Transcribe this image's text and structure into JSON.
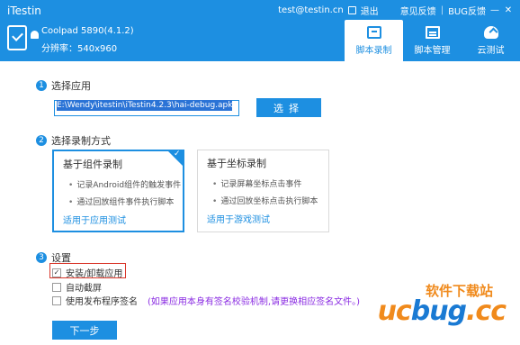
{
  "app": {
    "title": "iTestin"
  },
  "top_bar": {
    "email": "test@testin.cn",
    "logout": "退出",
    "feedback": "意见反馈",
    "bug_feedback": "BUG反馈",
    "separator": "|",
    "minimize": "—",
    "close": "✕"
  },
  "device": {
    "name": "Coolpad 5890(4.1.2)",
    "resolution": "分辨率：540x960"
  },
  "tabs": [
    {
      "label": "脚本录制",
      "icon": "script-record-icon",
      "active": true
    },
    {
      "label": "脚本管理",
      "icon": "script-manage-icon",
      "active": false
    },
    {
      "label": "云测试",
      "icon": "cloud-test-icon",
      "active": false
    }
  ],
  "steps": {
    "select_app": {
      "num": "1",
      "label": "选择应用"
    },
    "record_mode": {
      "num": "2",
      "label": "选择录制方式"
    },
    "settings": {
      "num": "3",
      "label": "设置"
    }
  },
  "app_path": {
    "value": "E:\\Wendy\\itestin\\iTestin4.2.3\\hai-debug.apk"
  },
  "select_button": "选择",
  "record_modes": [
    {
      "title": "基于组件录制",
      "bullets": [
        "记录Android组件的触发事件",
        "通过回放组件事件执行脚本"
      ],
      "link": "适用于应用测试",
      "active": true
    },
    {
      "title": "基于坐标录制",
      "bullets": [
        "记录屏幕坐标点击事件",
        "通过回放坐标点击执行脚本"
      ],
      "link": "适用于游戏测试",
      "active": false
    }
  ],
  "settings": {
    "install_uninstall": {
      "label": "安装/卸载应用",
      "checked": true
    },
    "auto_screenshot": {
      "label": "自动截屏",
      "checked": false
    },
    "use_release_sign": {
      "label": "使用发布程序签名",
      "checked": false
    },
    "sign_note": "(如果应用本身有签名校验机制,请更换相应签名文件。)"
  },
  "next_button": "下一步",
  "watermark": {
    "small": "软件下载站",
    "big_prefix": "uc",
    "big_mid": "bug",
    "big_suffix": ".cc"
  },
  "colors": {
    "primary": "#1d8fe1",
    "highlight_border": "#d9372b",
    "note": "#8a2be2",
    "watermark_orange": "#f08a1c"
  }
}
